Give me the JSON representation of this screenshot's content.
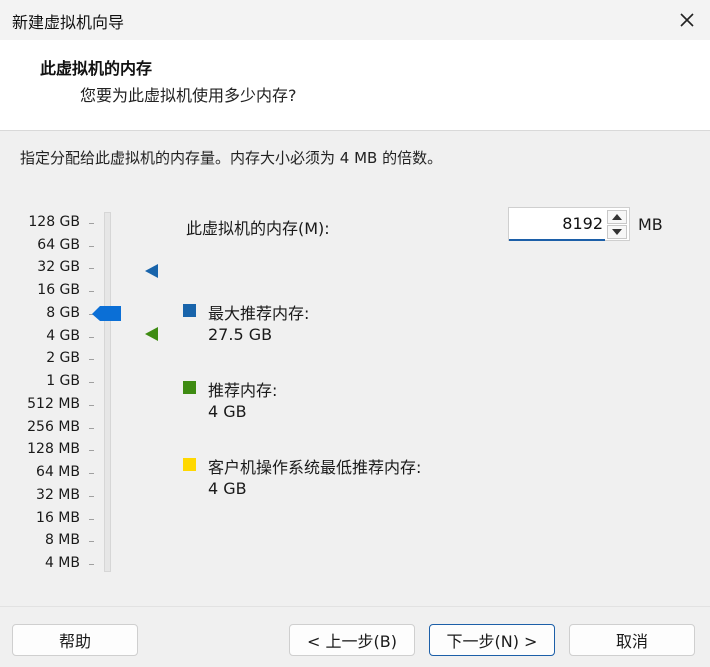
{
  "window": {
    "title": "新建虚拟机向导"
  },
  "header": {
    "title": "此虚拟机的内存",
    "subtitle": "您要为此虚拟机使用多少内存?"
  },
  "instructions": "指定分配给此虚拟机的内存量。内存大小必须为 4 MB 的倍数。",
  "memory_scale": {
    "ticks": [
      "128 GB",
      "64 GB",
      "32 GB",
      "16 GB",
      "8 GB",
      "4 GB",
      "2 GB",
      "1 GB",
      "512 MB",
      "256 MB",
      "128 MB",
      "64 MB",
      "32 MB",
      "16 MB",
      "8 MB",
      "4 MB"
    ],
    "selected": "8 GB"
  },
  "memory_field": {
    "label": "此虚拟机的内存(M):",
    "value": "8192",
    "unit": "MB"
  },
  "legend": [
    {
      "label": "最大推荐内存:",
      "value": "27.5 GB",
      "color": "#1864ab"
    },
    {
      "label": "推荐内存:",
      "value": "4 GB",
      "color": "#3e8b12"
    },
    {
      "label": "客户机操作系统最低推荐内存:",
      "value": "4 GB",
      "color": "#ffd800"
    }
  ],
  "buttons": {
    "help": "帮助",
    "back": "< 上一步(B)",
    "next": "下一步(N) >",
    "cancel": "取消"
  },
  "colors": {
    "accent": "#1c5fa8",
    "thumb": "#0b6fd6"
  }
}
